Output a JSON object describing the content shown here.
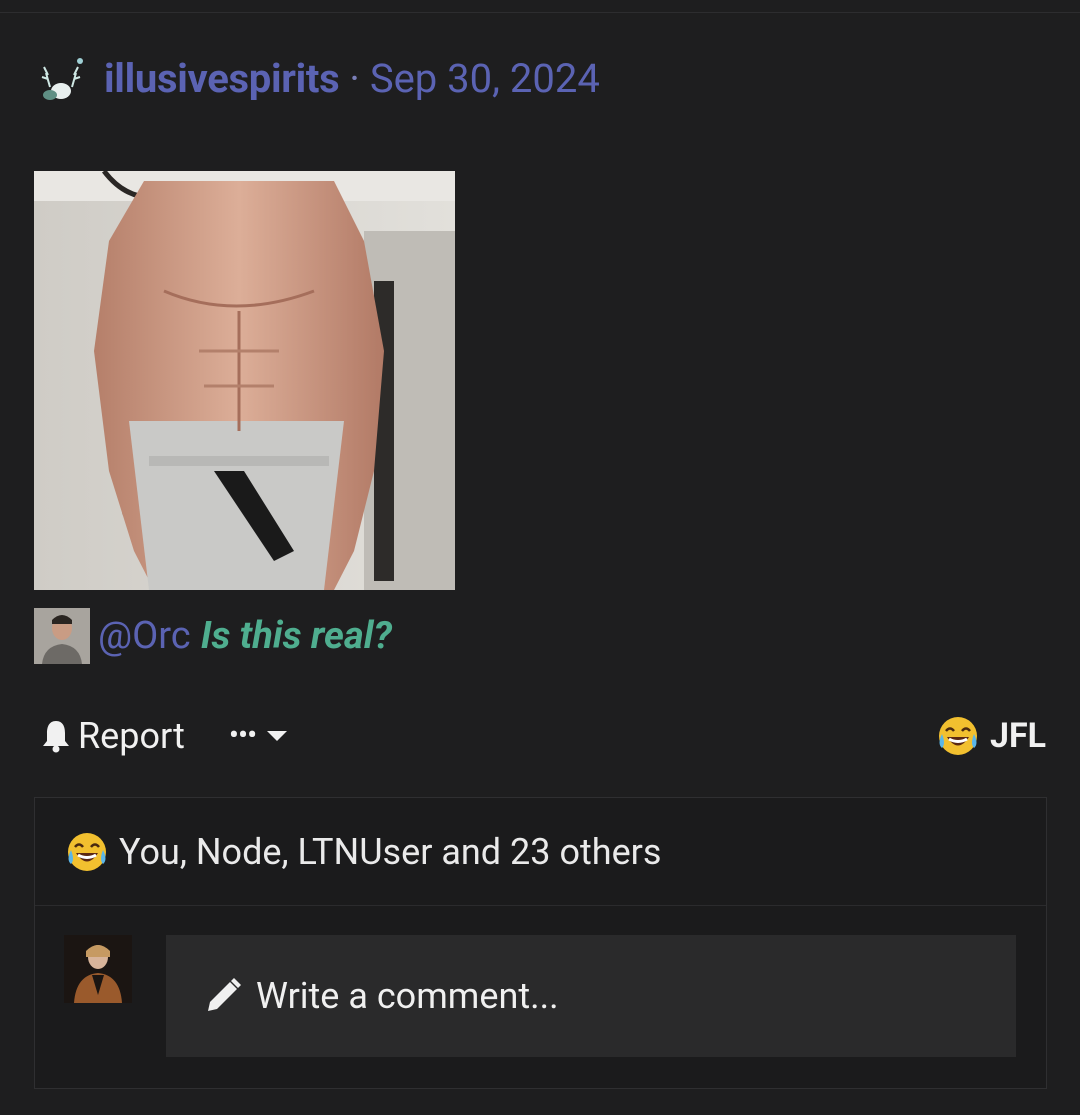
{
  "post": {
    "author": "illusivespirits",
    "separator": "·",
    "date": "Sep 30, 2024",
    "mention": "@Orc",
    "quote": "Is this real?"
  },
  "actions": {
    "report_label": "Report",
    "more_label": "•••",
    "reaction_label": "JFL"
  },
  "reactions": {
    "summary": "You, Node, LTNUser and 23 others"
  },
  "comment": {
    "placeholder": "Write a comment..."
  },
  "colors": {
    "background": "#1e1e1f",
    "username": "#5b63b3",
    "quote": "#4fae8f",
    "input_bg": "#2a2a2b"
  },
  "icons": {
    "report": "bell-icon",
    "more": "ellipsis-icon",
    "caret": "caret-down-icon",
    "reaction": "laughing-crying-emoji-icon",
    "comment": "pencil-icon"
  }
}
